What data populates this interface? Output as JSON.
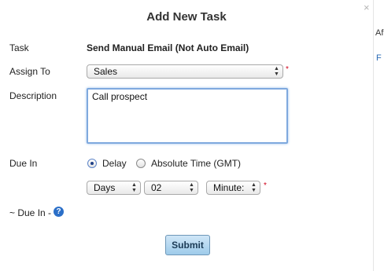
{
  "dialog": {
    "title": "Add New Task",
    "close_glyph": "×"
  },
  "task": {
    "label": "Task",
    "value": "Send Manual Email (Not Auto Email)"
  },
  "assign_to": {
    "label": "Assign To",
    "selected": "Sales",
    "required_mark": "*"
  },
  "description": {
    "label": "Description",
    "value": "Call prospect"
  },
  "due_in": {
    "label": "Due In",
    "options": [
      {
        "label": "Delay",
        "checked": true
      },
      {
        "label": "Absolute Time (GMT)",
        "checked": false
      }
    ],
    "unit_selected": "Days",
    "amount_selected": "02",
    "sub_unit_selected": "Minute:",
    "required_mark": "*"
  },
  "due_in_summary": {
    "label": "~ Due In -",
    "help_glyph": "?"
  },
  "actions": {
    "submit_label": "Submit"
  },
  "background_fragments": [
    "Af",
    "F"
  ],
  "colors": {
    "required": "#d0021b",
    "help_icon": "#2b6fc8",
    "focus_border": "#7fa9de",
    "submit_top": "#cfe6f7",
    "submit_bottom": "#9ecbea"
  }
}
